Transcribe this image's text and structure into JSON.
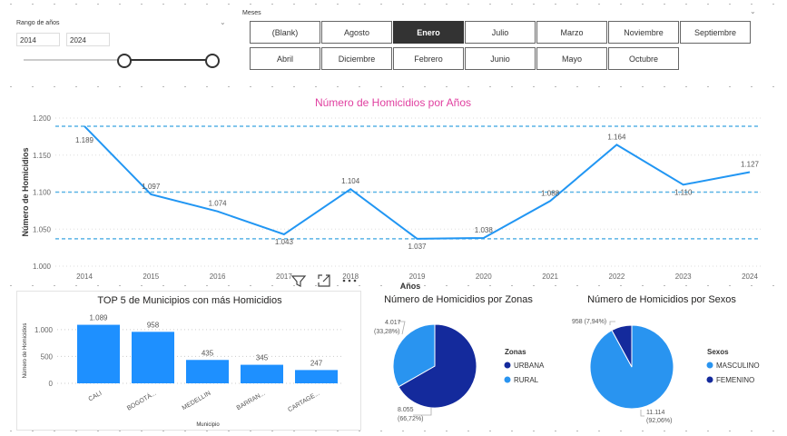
{
  "year_slicer": {
    "title": "Rango de años",
    "from": "2014",
    "to": "2024"
  },
  "month_slicer": {
    "title": "Meses",
    "buttons_row1": [
      "(Blank)",
      "Agosto",
      "Enero",
      "Julio",
      "Marzo",
      "Noviembre",
      "Septiembre"
    ],
    "buttons_row2": [
      "Abril",
      "Diciembre",
      "Febrero",
      "Junio",
      "Mayo",
      "Octubre"
    ],
    "selected": "Enero"
  },
  "visual_header_icons": [
    "filter-icon",
    "focus-mode-icon",
    "more-options-icon"
  ],
  "colors": {
    "line": "#2196F3",
    "bar": "#1E90FF",
    "urbana": "#142A9C",
    "rural": "#2994F0",
    "masculino": "#2994F0",
    "femenino": "#142A9C",
    "title_pink": "#E040A0"
  },
  "chart_data": [
    {
      "type": "line",
      "title": "Número de Homicidios por Años",
      "xlabel": "Años",
      "ylabel": "Número de Homicidios",
      "x": [
        "2014",
        "2015",
        "2016",
        "2017",
        "2018",
        "2019",
        "2020",
        "2021",
        "2022",
        "2023",
        "2024"
      ],
      "values": [
        1189,
        1097,
        1074,
        1043,
        1104,
        1037,
        1038,
        1088,
        1164,
        1110,
        1127
      ],
      "labels": [
        "1.189",
        "1.097",
        "1.074",
        "1.043",
        "1.104",
        "1.037",
        "1.038",
        "1.088",
        "1.164",
        "1.110",
        "1.127"
      ],
      "yticks": [
        "1.000",
        "1.050",
        "1.100",
        "1.150",
        "1.200"
      ],
      "ylim": [
        1000,
        1200
      ],
      "reference_lines": [
        1189,
        1100,
        1037
      ]
    },
    {
      "type": "bar",
      "title": "TOP 5 de Municipios con más Homicidios",
      "xlabel": "Municipio",
      "ylabel": "Número de Homicidios",
      "categories": [
        "CALI",
        "BOGOTÁ...",
        "MEDELLIN",
        "BARRAN...",
        "CARTAGE..."
      ],
      "values": [
        1089,
        958,
        435,
        345,
        247
      ],
      "labels": [
        "1.089",
        "958",
        "435",
        "345",
        "247"
      ],
      "yticks": [
        "0",
        "500",
        "1.000"
      ],
      "ylim": [
        0,
        1200
      ]
    },
    {
      "type": "pie",
      "title": "Número de Homicidios por Zonas",
      "legend_title": "Zonas",
      "slices": [
        {
          "name": "URBANA",
          "value": 8055,
          "label": "8.055",
          "pct": "(66,72%)"
        },
        {
          "name": "RURAL",
          "value": 4017,
          "label": "4.017",
          "pct": "(33,28%)"
        }
      ]
    },
    {
      "type": "pie",
      "title": "Número de Homicidios por Sexos",
      "legend_title": "Sexos",
      "slices": [
        {
          "name": "MASCULINO",
          "value": 11114,
          "label": "11.114",
          "pct": "(92,06%)"
        },
        {
          "name": "FEMENINO",
          "value": 958,
          "label": "958 (7,94%)",
          "pct": ""
        }
      ]
    }
  ]
}
